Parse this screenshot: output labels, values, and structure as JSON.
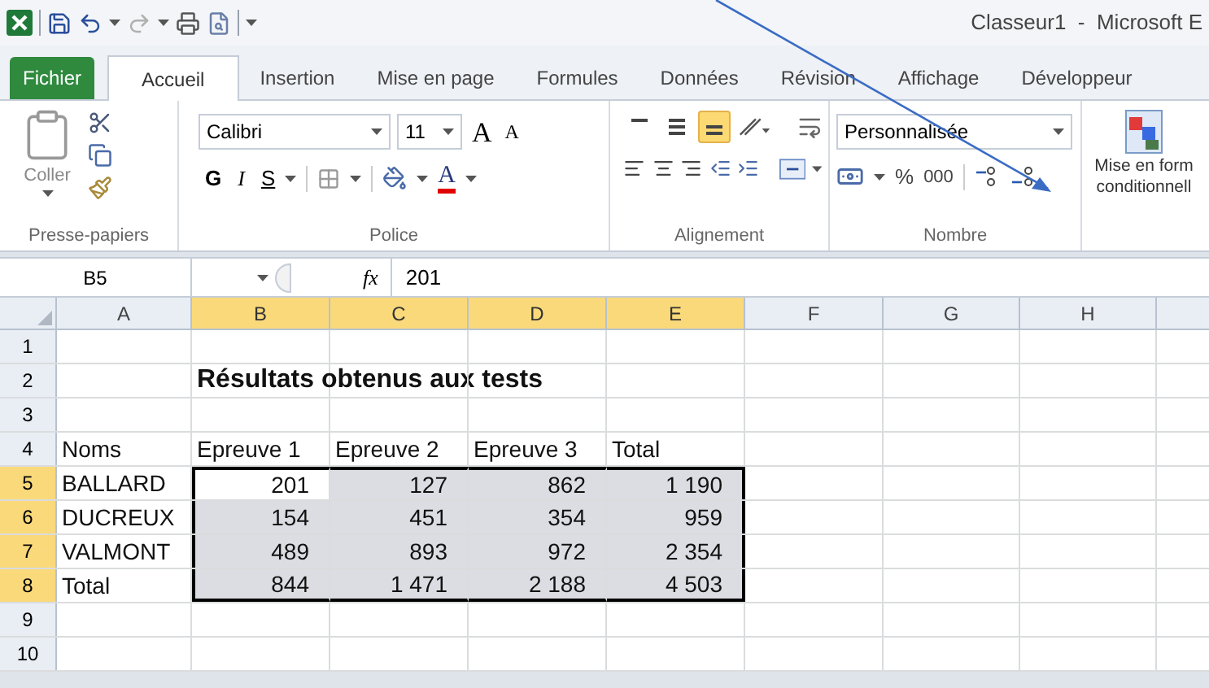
{
  "window": {
    "title": "Classeur1  -  Microsoft E"
  },
  "tabs": [
    {
      "label": "Fichier",
      "kind": "file"
    },
    {
      "label": "Accueil",
      "kind": "tab",
      "selected": true
    },
    {
      "label": "Insertion",
      "kind": "tab",
      "selected": false
    },
    {
      "label": "Mise en page",
      "kind": "tab",
      "selected": false
    },
    {
      "label": "Formules",
      "kind": "tab",
      "selected": false
    },
    {
      "label": "Données",
      "kind": "tab",
      "selected": false
    },
    {
      "label": "Révision",
      "kind": "tab",
      "selected": false
    },
    {
      "label": "Affichage",
      "kind": "tab",
      "selected": false
    },
    {
      "label": "Développeur",
      "kind": "tab",
      "selected": false
    }
  ],
  "ribbon": {
    "clipboard": {
      "paste": "Coller",
      "label": "Presse-papiers"
    },
    "font": {
      "name": "Calibri",
      "size": "11",
      "grow": "A",
      "shrink": "A",
      "bold": "G",
      "italic": "I",
      "underline": "S",
      "font_color_letter": "A",
      "label": "Police"
    },
    "alignment": {
      "align_buttons": [
        {
          "kind": "top",
          "selected": false
        },
        {
          "kind": "middle",
          "selected": false
        },
        {
          "kind": "bottom",
          "selected": true
        }
      ],
      "label": "Alignement"
    },
    "number": {
      "format": "Personnalisée",
      "percent": "%",
      "thousands": "000",
      "label": "Nombre"
    },
    "styles": {
      "conditional_format": [
        "Mise en form",
        "conditionnell"
      ]
    }
  },
  "formula_bar": {
    "name_box": "B5",
    "fx": "fx",
    "formula": "201"
  },
  "sheet": {
    "columns": [
      {
        "label": "A",
        "selected": false
      },
      {
        "label": "B",
        "selected": true
      },
      {
        "label": "C",
        "selected": true
      },
      {
        "label": "D",
        "selected": true
      },
      {
        "label": "E",
        "selected": true
      },
      {
        "label": "F",
        "selected": false
      },
      {
        "label": "G",
        "selected": false
      },
      {
        "label": "H",
        "selected": false
      }
    ],
    "rows": [
      {
        "label": "1",
        "kind": "blank",
        "selected": false,
        "cells": []
      },
      {
        "label": "2",
        "kind": "title",
        "selected": false,
        "cells": [
          null,
          "Résultats obtenus aux tests"
        ]
      },
      {
        "label": "3",
        "kind": "blank",
        "selected": false,
        "cells": []
      },
      {
        "label": "4",
        "kind": "header",
        "selected": false,
        "cells": [
          "Noms",
          "Epreuve 1",
          "Epreuve 2",
          "Epreuve 3",
          "Total"
        ]
      },
      {
        "label": "5",
        "kind": "data",
        "selected": true,
        "cells": [
          "BALLARD",
          {
            "text": "201",
            "active": true
          },
          "127",
          "862",
          "1 190"
        ]
      },
      {
        "label": "6",
        "kind": "data",
        "selected": true,
        "cells": [
          "DUCREUX",
          "154",
          "451",
          "354",
          "959"
        ]
      },
      {
        "label": "7",
        "kind": "data",
        "selected": true,
        "cells": [
          "VALMONT",
          "489",
          "893",
          "972",
          "2 354"
        ]
      },
      {
        "label": "8",
        "kind": "data",
        "selected": true,
        "cells": [
          "Total",
          "844",
          "1 471",
          "2 188",
          "4 503"
        ]
      },
      {
        "label": "9",
        "kind": "blank",
        "selected": false,
        "cells": []
      },
      {
        "label": "10",
        "kind": "blank",
        "selected": false,
        "cells": []
      }
    ]
  }
}
